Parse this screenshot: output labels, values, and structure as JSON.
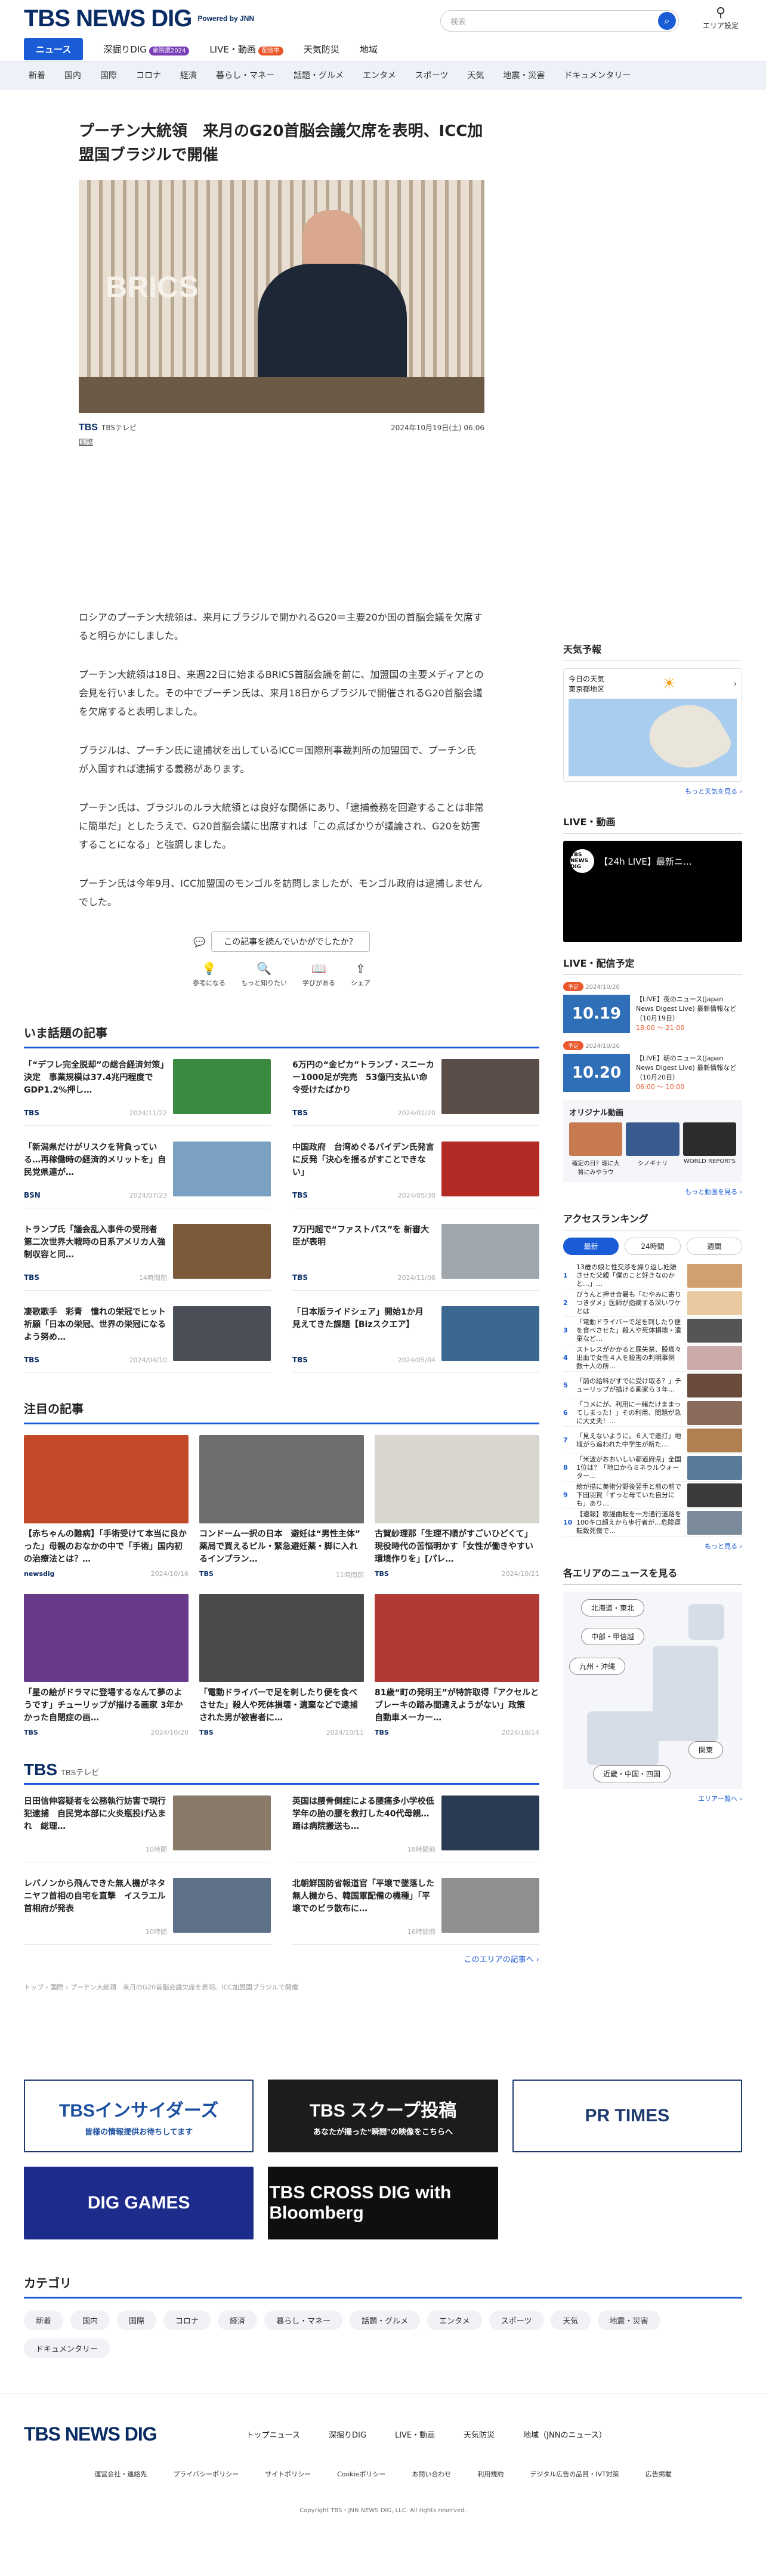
{
  "header": {
    "logo": "TBS NEWS DIG",
    "powered": "Powered by JNN",
    "search_placeholder": "検索",
    "area": "エリア設定"
  },
  "nav_main": [
    {
      "label": "ニュース"
    },
    {
      "label": "深掘りDIG",
      "badge": "衆院選2024",
      "badge_color": "#7a3fb8"
    },
    {
      "label": "LIVE・動画",
      "badge": "配信中",
      "badge_color": "#e9572b"
    },
    {
      "label": "天気防災"
    },
    {
      "label": "地域"
    }
  ],
  "nav_sub": [
    "新着",
    "国内",
    "国際",
    "コロナ",
    "経済",
    "暮らし・マネー",
    "話題・グルメ",
    "エンタメ",
    "スポーツ",
    "天気",
    "地震・災害",
    "ドキュメンタリー"
  ],
  "article": {
    "title": "プーチン大統領　来月のG20首脳会議欠席を表明、ICC加盟国ブラジルで開催",
    "hero_text": "BRICS",
    "source_logo": "TBS",
    "source": "TBSテレビ",
    "date": "2024年10月19日(土) 06:06",
    "category": "国際",
    "paragraphs": [
      "ロシアのプーチン大統領は、来月にブラジルで開かれるG20＝主要20か国の首脳会議を欠席すると明らかにしました。",
      "プーチン大統領は18日、来週22日に始まるBRICS首脳会議を前に、加盟国の主要メディアとの会見を行いました。その中でプーチン氏は、来月18日からブラジルで開催されるG20首脳会議を欠席すると表明しました。",
      "ブラジルは、プーチン氏に逮捕状を出しているICC＝国際刑事裁判所の加盟国で、プーチン氏が入国すれば逮捕する義務があります。",
      "プーチン氏は、ブラジルのルラ大統領とは良好な関係にあり、「逮捕義務を回避することは非常に簡単だ」としたうえで、G20首脳会議に出席すれば「この点ばかりが議論され、G20を妨害することになる」と強調しました。",
      "プーチン氏は今年9月、ICC加盟国のモンゴルを訪問しましたが、モンゴル政府は逮捕しませんでした。"
    ],
    "ask": "この記事を読んでいかがでしたか？",
    "reactions": [
      {
        "icon": "💡",
        "label": "参考になる"
      },
      {
        "icon": "🔍",
        "label": "もっと知りたい"
      },
      {
        "icon": "📖",
        "label": "学びがある"
      },
      {
        "icon": "⇪",
        "label": "シェア"
      }
    ]
  },
  "trending": {
    "title": "いま話題の記事",
    "items": [
      {
        "title": "「“デフレ完全脱却”の総合経済対策」決定　事業規模は37.4兆円程度でGDP1.2%押し…",
        "src": "TBS",
        "date": "2024/11/22",
        "color": "#3b8a3f"
      },
      {
        "title": "6万円の“金ピカ”トランプ・スニーカー1000足が完売　53億円支払い命令受けたばかり",
        "src": "TBS",
        "date": "2024/02/20",
        "color": "#5a4d47"
      },
      {
        "title": "「新潟県だけがリスクを背負っている…再稼働時の経済的メリットを」自民党県連が…",
        "src": "BSN",
        "date": "2024/07/23",
        "color": "#7aa0c2"
      },
      {
        "title": "中国政府　台湾めぐるバイデン氏発言に反発「決心を揺るがすことできない」",
        "src": "TBS",
        "date": "2024/05/30",
        "color": "#b42a24"
      },
      {
        "title": "トランプ氏「議会乱入事件の受刑者 第二次世界大戦時の日系アメリカ人強制収容と同…",
        "src": "TBS",
        "date": "14時間前",
        "color": "#7b5a3c"
      },
      {
        "title": "7万円超で“ファストパス”を 新審大臣が表明",
        "src": "TBS",
        "date": "2024/11/06",
        "color": "#9fa7ad"
      },
      {
        "title": "凄歌歌手　彩青　憧れの栄冠でヒット祈願「日本の栄冠、世界の栄冠になるよう努め…",
        "src": "TBS",
        "date": "2024/04/10",
        "color": "#4b4f58"
      },
      {
        "title": "「日本版ライドシェア」開始1か月　見えてきた課題【Bizスクエア】",
        "src": "TBS",
        "date": "2024/05/04",
        "color": "#3a6890"
      }
    ]
  },
  "featured": {
    "title": "注目の記事",
    "items": [
      {
        "title": "【赤ちゃんの難病】「手術受けて本当に良かった」母親のおなかの中で「手術」国内初の治療法とは？…",
        "src": "newsdig",
        "date": "2024/10/16",
        "color": "#c24a2b"
      },
      {
        "title": "コンドーム一択の日本　避妊は“男性主体”　薬局で買えるピル・緊急避妊薬・脚に入れるインプラン…",
        "src": "TBS",
        "date": "11時間前",
        "color": "#6e6e6e"
      },
      {
        "title": "古賀紗理那「生理不順がすごいひどくて」現役時代の苦悩明かす「女性が働きやすい環境作りを」[パレ…",
        "src": "TBS",
        "date": "2024/10/21",
        "color": "#d9d6d0"
      },
      {
        "title": "「星の絵がドラマに登場するなんて夢のようです」チューリップが描ける画家 3年かかった自閉症の画…",
        "src": "TBS",
        "date": "2024/10/20",
        "color": "#6a3a8a"
      },
      {
        "title": "「電動ドライバーで足を刺したり便を食べさせた」殺人や死体損壊・遺棄などで逮捕された男が被害者に…",
        "src": "TBS",
        "date": "2024/10/11",
        "color": "#4a4a4a"
      },
      {
        "title": "81歳“町の発明王”が特許取得「アクセルとブレーキの踏み間違えようがない」政策　自動車メーカー…",
        "src": "TBS",
        "date": "2024/10/14",
        "color": "#b23a35"
      }
    ]
  },
  "tbs": {
    "title": "TBS",
    "sub": "TBSテレビ",
    "items": [
      {
        "title": "日田信伸容疑者を公務執行妨害で現行犯逮捕　自民党本部に火炎瓶投げ込まれ　総理…",
        "date": "10時間",
        "color": "#8a7a6a"
      },
      {
        "title": "英国は腰骨側症による腰痛多小学校低学年の胎の腰を救打した40代母親…踊は病院搬送も…",
        "date": "18時間前",
        "color": "#2a3a52"
      },
      {
        "title": "レバノンから飛んできた無人機がネタニヤフ首相の自宅を直撃　イスラエル首相府が発表",
        "date": "10時間",
        "color": "#5f7089"
      },
      {
        "title": "北朝鮮国防省報道官「平壌で墜落した無人機から、韓国軍配備の機種」「平壌でのビラ散布に…",
        "date": "16時間前",
        "color": "#8d8f91"
      }
    ],
    "more": "このエリアの記事へ ›"
  },
  "breadcrumb": "トップ › 国際 › プーチン大統領　来月のG20首脳会議欠席を表明、ICC加盟国ブラジルで開催",
  "banners": [
    {
      "label": "TBSインサイダーズ",
      "sub": "皆様の情報提供お待ちしてます",
      "color": "#1b4fa0",
      "bg": "#fff"
    },
    {
      "label": "TBS スクープ投稿",
      "sub": "あなたが撮った“瞬間”の映像をこちらへ",
      "color": "#fff",
      "bg": "#1c1c1c"
    },
    {
      "label": "PR TIMES",
      "color": "#1e3b70",
      "bg": "#fff"
    },
    {
      "label": "DIG GAMES",
      "color": "#fff",
      "bg": "#1d2c8a"
    },
    {
      "label": "TBS CROSS DIG with Bloomberg",
      "color": "#fff",
      "bg": "#0f0f0f"
    }
  ],
  "categories": {
    "title": "カテゴリ",
    "items": [
      "新着",
      "国内",
      "国際",
      "コロナ",
      "経済",
      "暮らし・マネー",
      "話題・グルメ",
      "エンタメ",
      "スポーツ",
      "天気",
      "地震・災害",
      "ドキュメンタリー"
    ]
  },
  "sidebar": {
    "weather": {
      "title": "天気予報",
      "today": "今日の天気",
      "region": "東京都地区",
      "more": "もっと天気を見る ›"
    },
    "live": {
      "title": "LIVE・動画",
      "video": "【24h LIVE】最新ニ…",
      "logo": "TBS NEWS DIG"
    },
    "schedule": {
      "title": "LIVE・配信予定",
      "items": [
        {
          "tag": "予定",
          "date": "2024/10/20",
          "thumb": "10.19",
          "title": "【LIVE】夜のニュース(Japan News Digest Live) 最新情報など（10月19日）",
          "time": "18:00 〜 21:00"
        },
        {
          "tag": "予定",
          "date": "2024/10/20",
          "thumb": "10.20",
          "title": "【LIVE】朝のニュース(Japan News Digest Live) 最新情報など（10月20日）",
          "time": "06:00 〜 10:00"
        }
      ]
    },
    "original": {
      "title": "オリジナル動画",
      "items": [
        "確定の日？理に大将にみやラウ",
        "シノギナリ",
        "WORLD REPORTS"
      ],
      "more": "もっと動画を見る ›"
    },
    "ranking": {
      "title": "アクセスランキング",
      "tabs": [
        "最新",
        "24時間",
        "週間"
      ],
      "items": [
        "13歳の娘と性交渉を繰り返し妊娠させた父親「僕のこと好きなのかと…」…",
        "びうんと押せ合暑も「むやみに寄りつきダメ」医師が指摘する深いワケとは",
        "「電動ドライバーで足を刺したり便を食べさせた」殺人や死体損壊・遺棄など…",
        "ストレスがかかると尿失禁、股痛々出血で女性４人を殺害の判明事例　数十人の所…",
        "「前の給料がすでに受け取る？」チューリップが描ける画家ら３年…",
        "「コメにが、利用に一緒だけままってしまった！」その利用、問題が急に大丈夫！…",
        "「見えないように。６人で連打」地域がら追われた中学生が新た…",
        "「米波がおおいしい都道府県」全国1位は？「地口からミネラルウォーター…",
        "絵が描に美術分野後翌手と前の前で下田羽賀「ずっと母ていた自分にも」あり…",
        "【速報】歌謡曲転を一方通行道路を100キロ超えから歩行者が…危険運転致死傷で…"
      ],
      "more": "もっと見る ›"
    },
    "area": {
      "title": "各エリアのニュースを見る",
      "pills": [
        "北海道・東北",
        "中部・甲信越",
        "九州・沖縄",
        "関東",
        "近畿・中国・四国"
      ],
      "more": "エリア一覧へ ›"
    }
  },
  "footer": {
    "logo": "TBS NEWS DIG",
    "links": [
      "トップニュース",
      "深掘りDIG",
      "LIVE・動画",
      "天気防災",
      "地域（JNNのニュース）"
    ],
    "sub": [
      "運営会社・連絡先",
      "プライバシーポリシー",
      "サイトポリシー",
      "Cookieポリシー",
      "お問い合わせ",
      "利用規約",
      "デジタル広告の品質・IVT対策",
      "広告掲載"
    ],
    "copy": "Copyright TBS・JNN NEWS DIG, LLC. All rights reserved."
  }
}
